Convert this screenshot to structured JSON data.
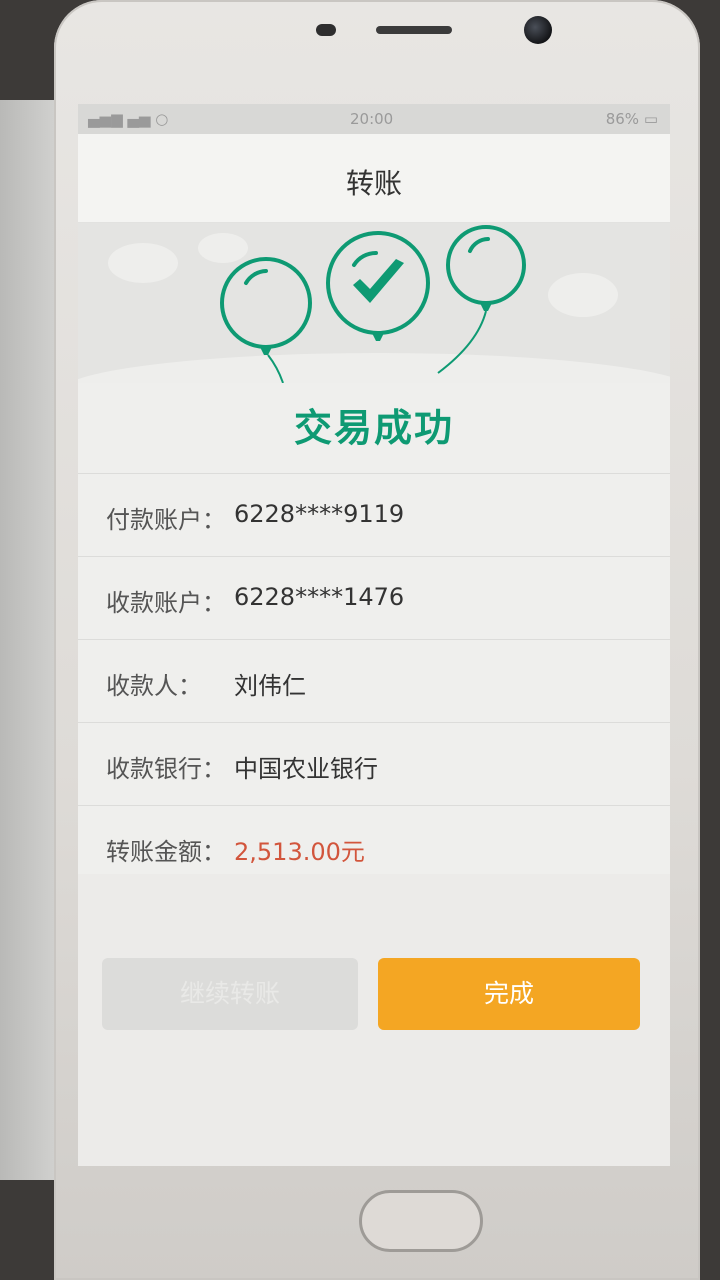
{
  "status_bar": {
    "signal": "▄▅▆ ▄▅ ○",
    "time": "20:00",
    "battery": "86%"
  },
  "header": {
    "title": "转账"
  },
  "result": {
    "status_text": "交易成功"
  },
  "details": [
    {
      "label": "付款账户：",
      "value": "6228****9119"
    },
    {
      "label": "收款账户：",
      "value": "6228****1476"
    },
    {
      "label": "收款人：",
      "value": "刘伟仁"
    },
    {
      "label": "收款银行：",
      "value": "中国农业银行"
    },
    {
      "label": "转账金额：",
      "value": "2,513.00元"
    }
  ],
  "actions": {
    "continue_label": "继续转账",
    "done_label": "完成"
  },
  "colors": {
    "accent_green": "#0e9a73",
    "amount_red": "#d2553c",
    "done_orange": "#f4a623"
  },
  "icons": [
    "check-icon",
    "balloon-icon"
  ]
}
